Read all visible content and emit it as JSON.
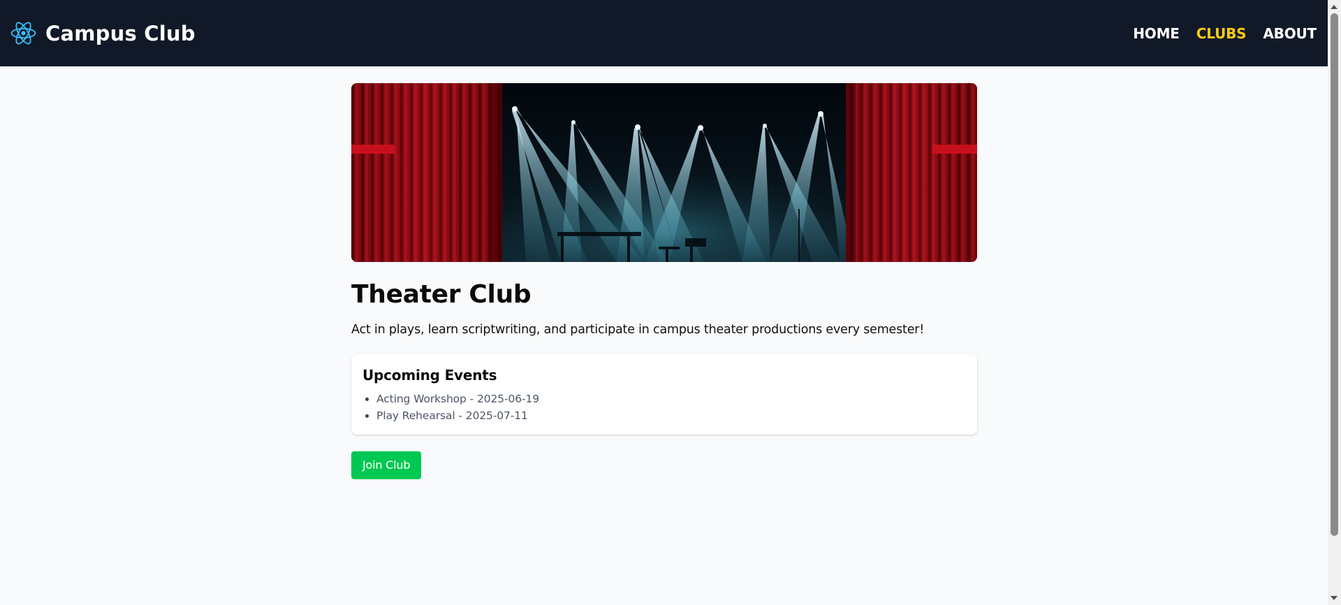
{
  "app": {
    "brand_title": "Campus Club",
    "brand_icon": "react-atom-icon",
    "brand_color": "#38bdf8",
    "header_bg": "#111827",
    "active_color": "#facc15"
  },
  "nav": {
    "items": [
      {
        "label": "HOME",
        "active": false
      },
      {
        "label": "CLUBS",
        "active": true
      },
      {
        "label": "ABOUT",
        "active": false
      }
    ]
  },
  "club": {
    "hero_image": "theater-stage-image",
    "title": "Theater Club",
    "description": "Act in plays, learn scriptwriting, and participate in campus theater productions every semester!",
    "events_heading": "Upcoming Events",
    "events": [
      "Acting Workshop - 2025-06-19",
      "Play Rehearsal - 2025-07-11"
    ],
    "join_label": "Join Club",
    "join_color": "#00c853"
  }
}
